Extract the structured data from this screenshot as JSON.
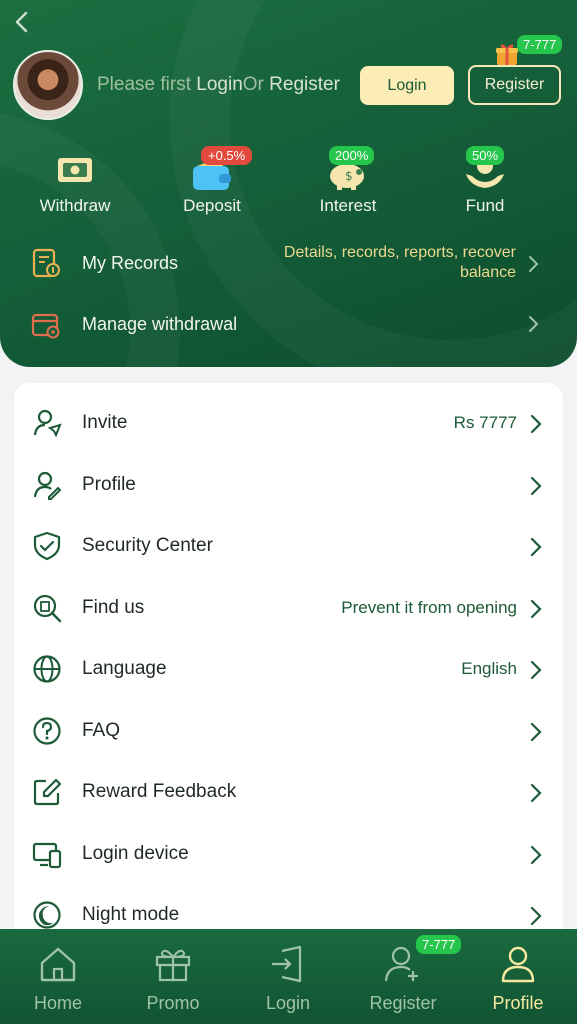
{
  "header": {
    "prompt_prefix": "Please first",
    "prompt_login": "Login",
    "prompt_or": "Or",
    "prompt_register": "Register",
    "login_button": "Login",
    "register_button": "Register",
    "register_badge": "7-777"
  },
  "quick_actions": [
    {
      "label": "Withdraw",
      "icon": "ticket-icon",
      "badge": ""
    },
    {
      "label": "Deposit",
      "icon": "wallet-icon",
      "badge": "+0.5%"
    },
    {
      "label": "Interest",
      "icon": "piggy-bank-icon",
      "badge": "200%"
    },
    {
      "label": "Fund",
      "icon": "hand-coin-icon",
      "badge": "50%"
    }
  ],
  "records": {
    "label": "My Records",
    "detail": "Details, records, reports, recover balance"
  },
  "manage_withdrawal": {
    "label": "Manage withdrawal"
  },
  "menu": [
    {
      "label": "Invite",
      "value": "Rs 7777",
      "icon": "invite-user-icon"
    },
    {
      "label": "Profile",
      "value": "",
      "icon": "user-edit-icon"
    },
    {
      "label": "Security Center",
      "value": "",
      "icon": "shield-check-icon"
    },
    {
      "label": "Find us",
      "value": "Prevent it from opening",
      "icon": "search-building-icon"
    },
    {
      "label": "Language",
      "value": "English",
      "icon": "globe-icon"
    },
    {
      "label": "FAQ",
      "value": "",
      "icon": "question-circle-icon"
    },
    {
      "label": "Reward Feedback",
      "value": "",
      "icon": "edit-square-icon"
    },
    {
      "label": "Login device",
      "value": "",
      "icon": "devices-icon"
    },
    {
      "label": "Night mode",
      "value": "",
      "icon": "moon-icon"
    }
  ],
  "tabbar": {
    "tabs": [
      {
        "label": "Home",
        "icon": "home-icon"
      },
      {
        "label": "Promo",
        "icon": "gift-icon"
      },
      {
        "label": "Login",
        "icon": "login-door-icon"
      },
      {
        "label": "Register",
        "icon": "user-add-icon"
      },
      {
        "label": "Profile",
        "icon": "user-icon"
      }
    ],
    "active": "Profile",
    "register_badge": "7-777"
  },
  "colors": {
    "primary": "#1a6a3f",
    "accent": "#f7e8a2",
    "badge_green": "#26c54b",
    "badge_red": "#e34a3e"
  }
}
